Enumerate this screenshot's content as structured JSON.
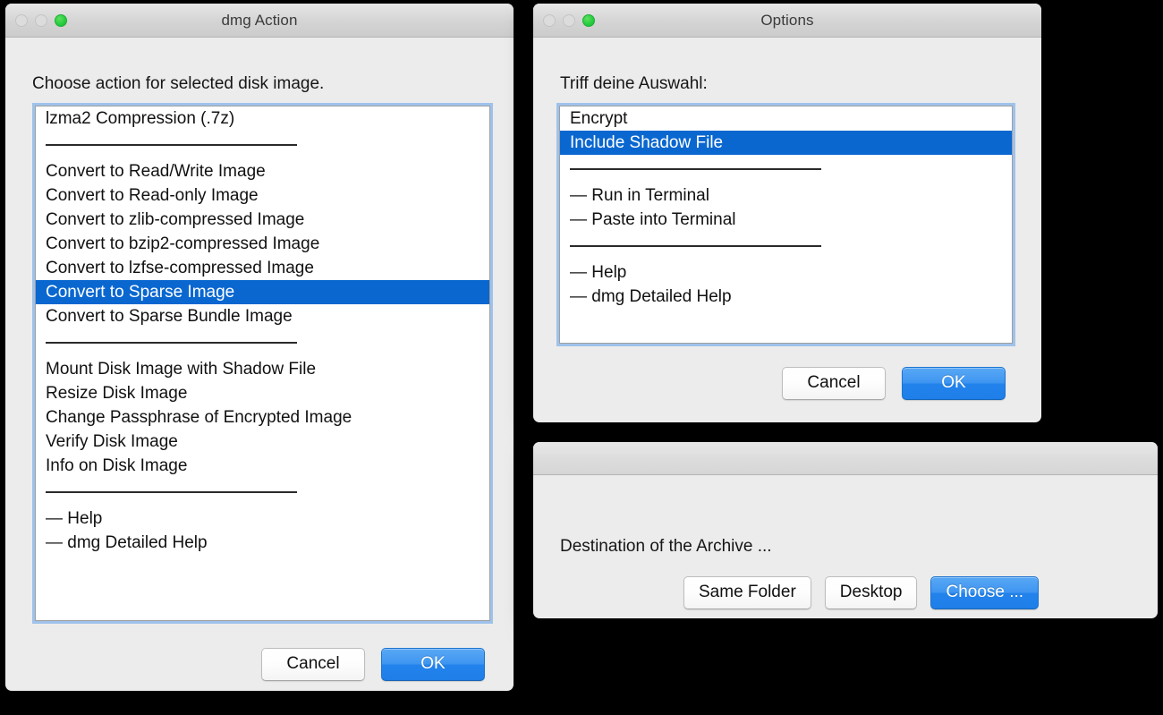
{
  "desktop": {
    "background": "#000000"
  },
  "colors": {
    "selection_blue": "#0a67d0",
    "primary_button_blue": "#2383ec",
    "focus_ring": "#86b4eb",
    "window_background": "#ececec"
  },
  "windows": {
    "dmg_action": {
      "title": "dmg Action",
      "traffic_lights": [
        {
          "name": "close-button",
          "state": "disabled"
        },
        {
          "name": "minimize-button",
          "state": "disabled"
        },
        {
          "name": "zoom-button",
          "state": "enabled",
          "color": "#28cd41"
        }
      ],
      "prompt": "Choose action for selected disk image.",
      "list": [
        {
          "label": "lzma2 Compression (.7z)",
          "type": "item",
          "selected": false
        },
        {
          "label": "",
          "type": "separator",
          "selected": false
        },
        {
          "label": "Convert to Read/Write Image",
          "type": "item",
          "selected": false
        },
        {
          "label": "Convert to Read-only Image",
          "type": "item",
          "selected": false
        },
        {
          "label": "Convert to zlib-compressed Image",
          "type": "item",
          "selected": false
        },
        {
          "label": "Convert to bzip2-compressed Image",
          "type": "item",
          "selected": false
        },
        {
          "label": "Convert to lzfse-compressed Image",
          "type": "item",
          "selected": false
        },
        {
          "label": "Convert to Sparse Image",
          "type": "item",
          "selected": true
        },
        {
          "label": "Convert to Sparse Bundle Image",
          "type": "item",
          "selected": false
        },
        {
          "label": "",
          "type": "separator",
          "selected": false
        },
        {
          "label": "Mount Disk Image with Shadow File",
          "type": "item",
          "selected": false
        },
        {
          "label": "Resize Disk Image",
          "type": "item",
          "selected": false
        },
        {
          "label": "Change Passphrase of Encrypted Image",
          "type": "item",
          "selected": false
        },
        {
          "label": "Verify Disk Image",
          "type": "item",
          "selected": false
        },
        {
          "label": "Info on Disk Image",
          "type": "item",
          "selected": false
        },
        {
          "label": "",
          "type": "separator",
          "selected": false
        },
        {
          "label": "— Help",
          "type": "item",
          "selected": false
        },
        {
          "label": "— dmg Detailed Help",
          "type": "item",
          "selected": false
        }
      ],
      "buttons": {
        "cancel": "Cancel",
        "ok": "OK"
      }
    },
    "options": {
      "title": "Options",
      "traffic_lights": [
        {
          "name": "close-button",
          "state": "disabled"
        },
        {
          "name": "minimize-button",
          "state": "disabled"
        },
        {
          "name": "zoom-button",
          "state": "enabled",
          "color": "#28cd41"
        }
      ],
      "prompt": "Triff deine Auswahl:",
      "list": [
        {
          "label": "Encrypt",
          "type": "item",
          "selected": false
        },
        {
          "label": "Include Shadow File",
          "type": "item",
          "selected": true
        },
        {
          "label": "",
          "type": "separator",
          "selected": false
        },
        {
          "label": "— Run in Terminal",
          "type": "item",
          "selected": false
        },
        {
          "label": "— Paste into Terminal",
          "type": "item",
          "selected": false
        },
        {
          "label": "",
          "type": "separator",
          "selected": false
        },
        {
          "label": "— Help",
          "type": "item",
          "selected": false
        },
        {
          "label": "— dmg Detailed Help",
          "type": "item",
          "selected": false
        }
      ],
      "buttons": {
        "cancel": "Cancel",
        "ok": "OK"
      }
    },
    "destination": {
      "title": "",
      "prompt": "Destination of the Archive ...",
      "buttons": {
        "same_folder": "Same Folder",
        "desktop": "Desktop",
        "choose": "Choose ..."
      }
    }
  }
}
